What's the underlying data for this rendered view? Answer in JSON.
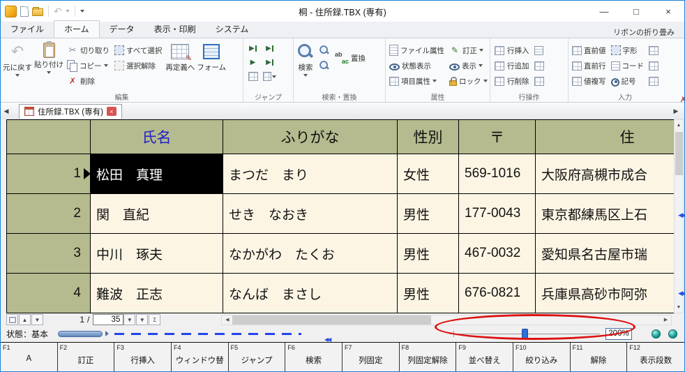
{
  "window": {
    "title": "桐 - 住所録.TBX (専有)"
  },
  "icons": {
    "undo": "↶",
    "cut": "✂",
    "pencil": "✎",
    "delete": "✗",
    "close": "×",
    "minimize": "—",
    "maximize": "□",
    "up": "▲",
    "down": "▼",
    "left": "◀",
    "right": "▶",
    "play": "▶",
    "sigma": "Σ",
    "split": "◀◀",
    "replace_from": "ab",
    "replace_to": "ac"
  },
  "ribbon": {
    "tabs": [
      {
        "label": "ファイル"
      },
      {
        "label": "ホーム"
      },
      {
        "label": "データ"
      },
      {
        "label": "表示・印刷"
      },
      {
        "label": "システム"
      }
    ],
    "collapse_label": "リボンの折り畳み",
    "groups": {
      "edit": {
        "label": "編集",
        "undo": "元に戻す",
        "paste": "貼り付け",
        "cut": "切り取り",
        "copy": "コピー",
        "del": "削除",
        "select_all": "すべて選択",
        "deselect": "選択解除",
        "redefine": "再定義へ",
        "form": "フォーム"
      },
      "jump": {
        "label": "ジャンプ"
      },
      "search": {
        "label": "検索・置換",
        "search": "検索",
        "replace": "置換"
      },
      "attr": {
        "label": "属性",
        "file_attr": "ファイル属性",
        "status_disp": "状態表示",
        "item_attr": "項目属性",
        "correct": "訂正",
        "disp": "表示",
        "lock": "ロック"
      },
      "rowops": {
        "label": "行操作",
        "insert": "行挿入",
        "append": "行追加",
        "del": "行削除"
      },
      "input": {
        "label": "入力",
        "prev_val": "直前値",
        "prev_row": "直前行",
        "val_copy": "値複写",
        "glyph": "字形",
        "code": "コード",
        "symbol": "記号"
      }
    }
  },
  "doc_tab": {
    "label": "住所録.TBX (専有)"
  },
  "table": {
    "headers": {
      "name": "氏名",
      "kana": "ふりがな",
      "gender": "性別",
      "zip": "〒",
      "address": "住"
    },
    "rows": [
      {
        "num": "1",
        "name": "松田　真理",
        "kana": "まつだ　まり",
        "gender": "女性",
        "zip": "569-1016",
        "address": "大阪府高槻市成合"
      },
      {
        "num": "2",
        "name": "関　直紀",
        "kana": "せき　なおき",
        "gender": "男性",
        "zip": "177-0043",
        "address": "東京都練馬区上石"
      },
      {
        "num": "3",
        "name": "中川　琢夫",
        "kana": "なかがわ　たくお",
        "gender": "男性",
        "zip": "467-0032",
        "address": "愛知県名古屋市瑞"
      },
      {
        "num": "4",
        "name": "難波　正志",
        "kana": "なんば　まさし",
        "gender": "男性",
        "zip": "676-0821",
        "address": "兵庫県高砂市阿弥"
      }
    ]
  },
  "nav": {
    "current": "1",
    "sep": "/",
    "total": "35"
  },
  "status": {
    "label": "状態：基本",
    "zoom": "200%"
  },
  "fkeys": [
    {
      "key": "F1",
      "label": "A"
    },
    {
      "key": "F2",
      "label": "訂正"
    },
    {
      "key": "F3",
      "label": "行挿入"
    },
    {
      "key": "F4",
      "label": "ウィンドウ替"
    },
    {
      "key": "F5",
      "label": "ジャンプ"
    },
    {
      "key": "F6",
      "label": "検索"
    },
    {
      "key": "F7",
      "label": "列固定"
    },
    {
      "key": "F8",
      "label": "列固定解除"
    },
    {
      "key": "F9",
      "label": "並べ替え"
    },
    {
      "key": "F10",
      "label": "絞り込み"
    },
    {
      "key": "F11",
      "label": "解除"
    },
    {
      "key": "F12",
      "label": "表示段数"
    }
  ],
  "colors": {
    "accent_blue": "#1883d7",
    "table_header_olive": "#b5bb8e",
    "cell_cream": "#fdf5e4",
    "selected_black": "#000000",
    "annotation_red": "#dd1111",
    "header_name_blue": "#1f1fc8"
  }
}
